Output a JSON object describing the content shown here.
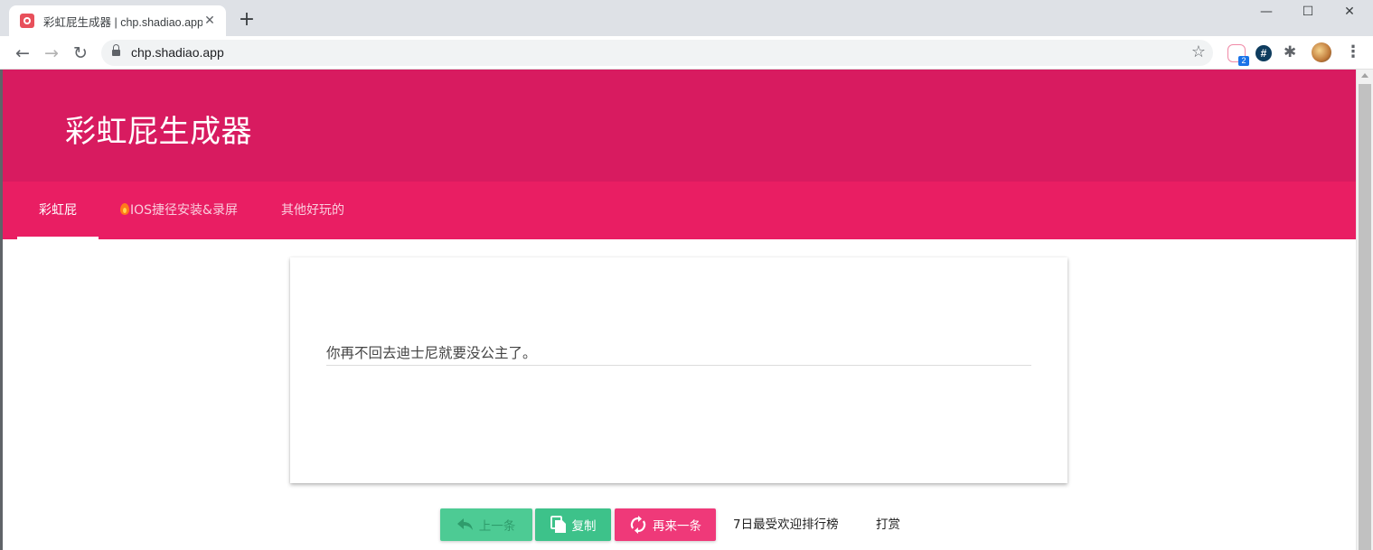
{
  "browser": {
    "tab_title": "彩虹屁生成器 | chp.shadiao.app",
    "tab_close": "✕",
    "new_tab": "+",
    "window_controls": {
      "minimize": "—",
      "maximize": "☐",
      "close": "✕"
    },
    "nav": {
      "back": "←",
      "forward": "→",
      "reload": "↻"
    },
    "url": "chp.shadiao.app",
    "bookmark_star": "☆",
    "extensions": {
      "cat_badge": "2",
      "hash_label": "#",
      "puzzle": "✱"
    },
    "menu": "⋮"
  },
  "header": {
    "title": "彩虹屁生成器"
  },
  "tabs": [
    {
      "label": "彩虹屁",
      "active": true
    },
    {
      "label": "IOS捷径安装&录屏",
      "icon": "flame-icon",
      "active": false
    },
    {
      "label": "其他好玩的",
      "active": false
    }
  ],
  "card": {
    "text": "你再不回去迪士尼就要没公主了。"
  },
  "actions": {
    "prev_label": "上一条",
    "copy_label": "复制",
    "next_label": "再来一条",
    "ranking_label": "7日最受欢迎排行榜",
    "tip_label": "打赏"
  },
  "colors": {
    "hero": "#d81b60",
    "tabs": "#e91e63",
    "copy_button": "#3dc28a",
    "prev_button": "#4dcb94",
    "next_button": "#ef3979"
  }
}
